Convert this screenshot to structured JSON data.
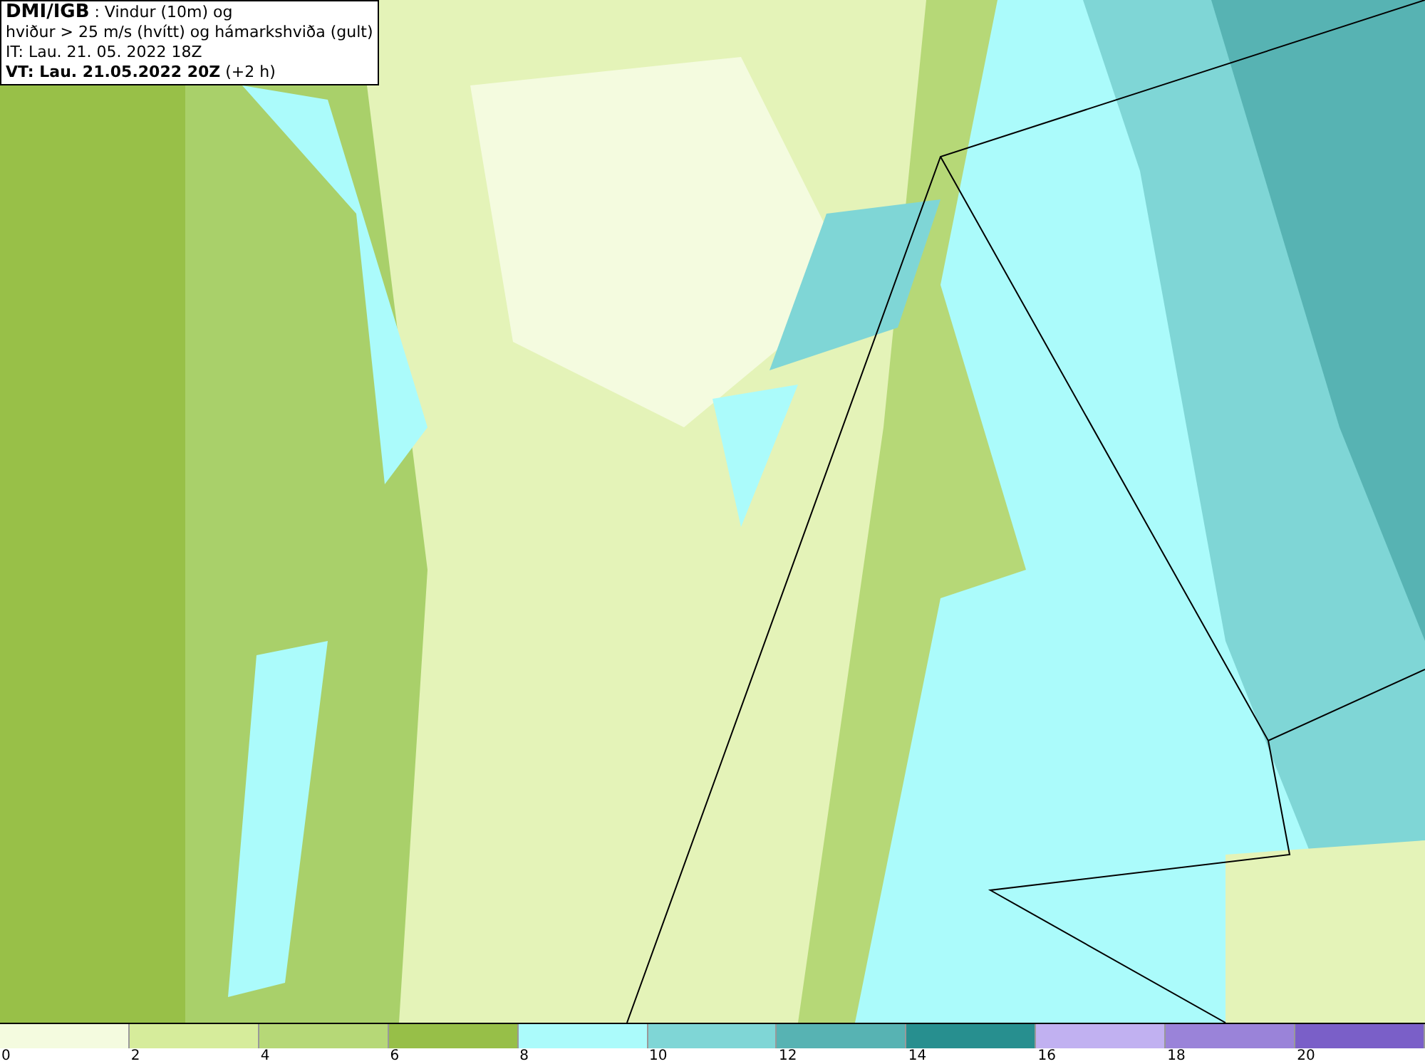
{
  "header": {
    "lines": [
      "**DMI/IGB** : Vindur (10m) og",
      "hviður > 25 m/s (hvítt) og hámarkshviða (gult)",
      "IT: Lau. 21. 05. 2022 18Z",
      "**VT: Lau. 21.05.2022 20Z** (+2 h)"
    ]
  },
  "legend": [
    {
      "label": "0",
      "color": "#f4fbdf"
    },
    {
      "label": "2",
      "color": "#d6ec9b"
    },
    {
      "label": "4",
      "color": "#b6d877"
    },
    {
      "label": "6",
      "color": "#97bf48"
    },
    {
      "label": "8",
      "color": "#abfbfb"
    },
    {
      "label": "10",
      "color": "#7fd6d6"
    },
    {
      "label": "12",
      "color": "#57b3b3"
    },
    {
      "label": "14",
      "color": "#278f8f"
    },
    {
      "label": "16",
      "color": "#c1b1f1"
    },
    {
      "label": "18",
      "color": "#9a83d9"
    },
    {
      "label": "20",
      "color": "#7a5fc8"
    }
  ]
}
